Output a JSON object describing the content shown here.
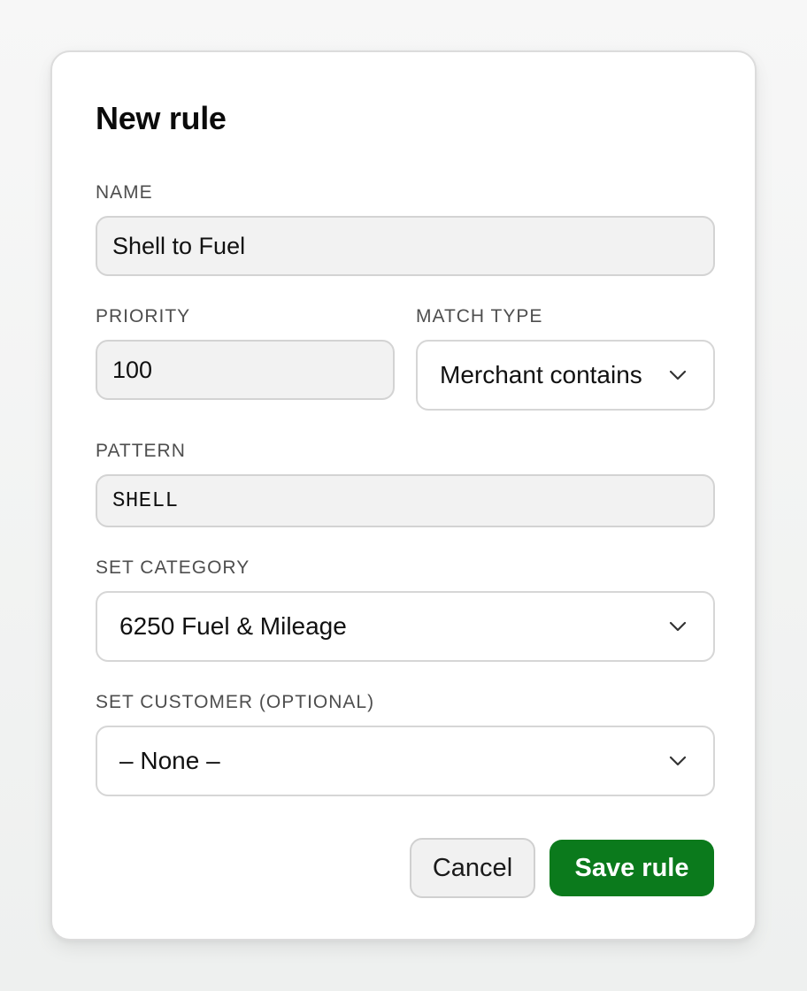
{
  "dialog": {
    "title": "New rule",
    "fields": {
      "name": {
        "label": "NAME",
        "value": "Shell to Fuel"
      },
      "priority": {
        "label": "PRIORITY",
        "value": "100"
      },
      "match_type": {
        "label": "MATCH TYPE",
        "selected": "Merchant contains"
      },
      "pattern": {
        "label": "PATTERN",
        "value": "SHELL"
      },
      "set_category": {
        "label": "SET CATEGORY",
        "selected": "6250 Fuel & Mileage"
      },
      "set_customer": {
        "label": "SET CUSTOMER (OPTIONAL)",
        "selected": "– None –"
      }
    },
    "buttons": {
      "cancel_label": "Cancel",
      "save_label": "Save rule"
    },
    "colors": {
      "primary": "#0b7a1c",
      "field_bg": "#f2f2f2",
      "border": "#d3d3d3"
    },
    "icons": {
      "select_caret": "chevron-down-icon"
    }
  }
}
